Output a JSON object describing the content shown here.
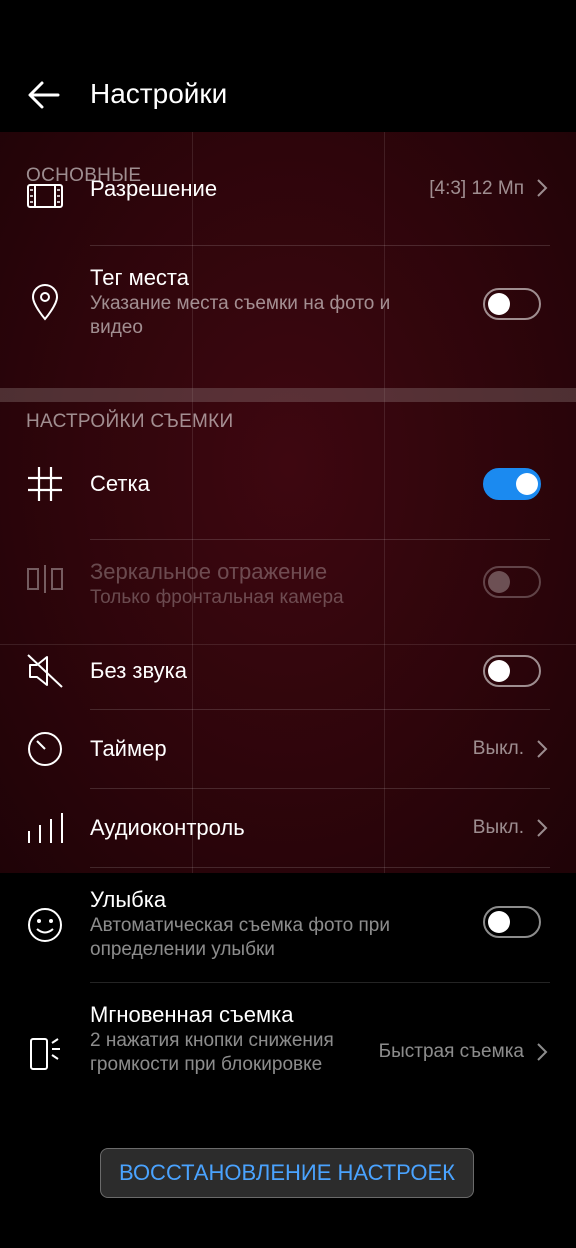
{
  "header": {
    "title": "Настройки",
    "back_icon": "arrow-left-icon"
  },
  "colors": {
    "accent": "#1b8af0",
    "link": "#4aa3ff",
    "preview_tint": "#3e0710"
  },
  "sections": {
    "basic_title": "ОСНОВНЫЕ",
    "capture_title": "НАСТРОЙКИ СЪЕМКИ"
  },
  "rows": {
    "resolution": {
      "label": "Разрешение",
      "value": "[4:3] 12 Мп",
      "icon": "resolution-icon"
    },
    "location": {
      "label": "Тег места",
      "sub": "Указание места съемки на фото и видео",
      "icon": "location-pin-icon",
      "enabled": false
    },
    "grid": {
      "label": "Сетка",
      "icon": "grid-icon",
      "enabled": true
    },
    "mirror": {
      "label": "Зеркальное отражение",
      "sub": "Только фронтальная камера",
      "icon": "mirror-icon",
      "enabled": false,
      "disabled": true
    },
    "mute": {
      "label": "Без звука",
      "icon": "sound-off-icon",
      "enabled": false
    },
    "timer": {
      "label": "Таймер",
      "value": "Выкл.",
      "icon": "timer-icon"
    },
    "audio": {
      "label": "Аудиоконтроль",
      "value": "Выкл.",
      "icon": "audio-control-icon"
    },
    "smile": {
      "label": "Улыбка",
      "sub": "Автоматическая съемка фото при определении улыбки",
      "icon": "smile-icon",
      "enabled": false
    },
    "instant": {
      "label": "Мгновенная съемка",
      "sub": "2 нажатия кнопки снижения громкости при блокировке",
      "value": "Быстрая съемка",
      "icon": "instant-capture-icon"
    }
  },
  "reset_button": "ВОССТАНОВЛЕНИЕ НАСТРОЕК"
}
